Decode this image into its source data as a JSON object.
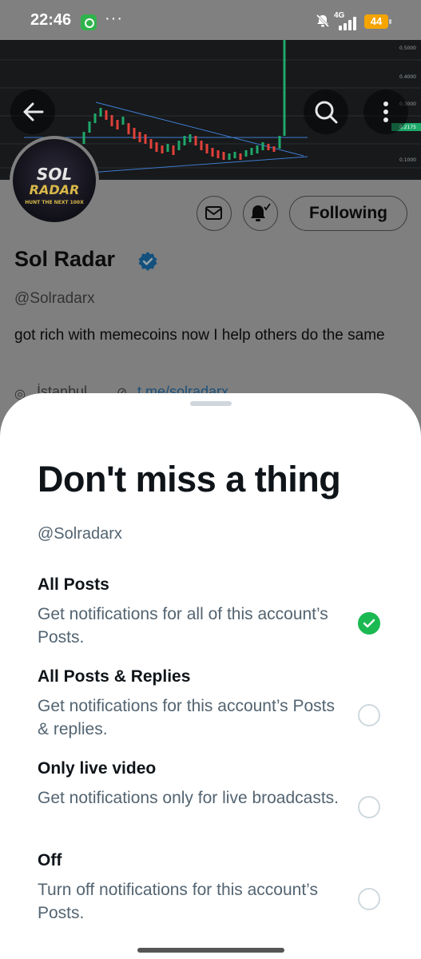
{
  "status_bar": {
    "time": "22:46",
    "more": "···",
    "network": "4G",
    "battery": "44",
    "battery_color": "#f5a400"
  },
  "banner": {
    "price_ticks": [
      "0.5000",
      "0.4000",
      "0.3000",
      "0.2175",
      "0.1000"
    ]
  },
  "avatar": {
    "line1": "SOL",
    "line2": "RADAR",
    "line3": "HUNT THE NEXT 100X"
  },
  "profile": {
    "following_label": "Following",
    "display_name": "Sol Radar",
    "handle": "@Solradarx",
    "bio": "got rich with memecoins now I help others do the same",
    "location": "İstanbul",
    "link": "t.me/solradarx"
  },
  "sheet": {
    "title": "Don't miss a thing",
    "handle": "@Solradarx",
    "accent": "#1ab952",
    "options": [
      {
        "title": "All Posts",
        "description": "Get notifications for all of this account’s Posts.",
        "selected": true
      },
      {
        "title": "All Posts & Replies",
        "description": "Get notifications for this account’s Posts & replies.",
        "selected": false
      },
      {
        "title": "Only live video",
        "description": "Get notifications only for live broadcasts.",
        "selected": false
      },
      {
        "title": "Off",
        "description": "Turn off notifications for this account’s Posts.",
        "selected": false
      }
    ]
  },
  "icons": [
    "whatsapp-icon",
    "mute-icon",
    "signal-icon",
    "back-arrow-icon",
    "search-icon",
    "more-vertical-icon",
    "mail-icon",
    "bell-subscribed-icon",
    "verified-badge-icon",
    "location-icon",
    "link-icon",
    "checkmark-icon"
  ]
}
